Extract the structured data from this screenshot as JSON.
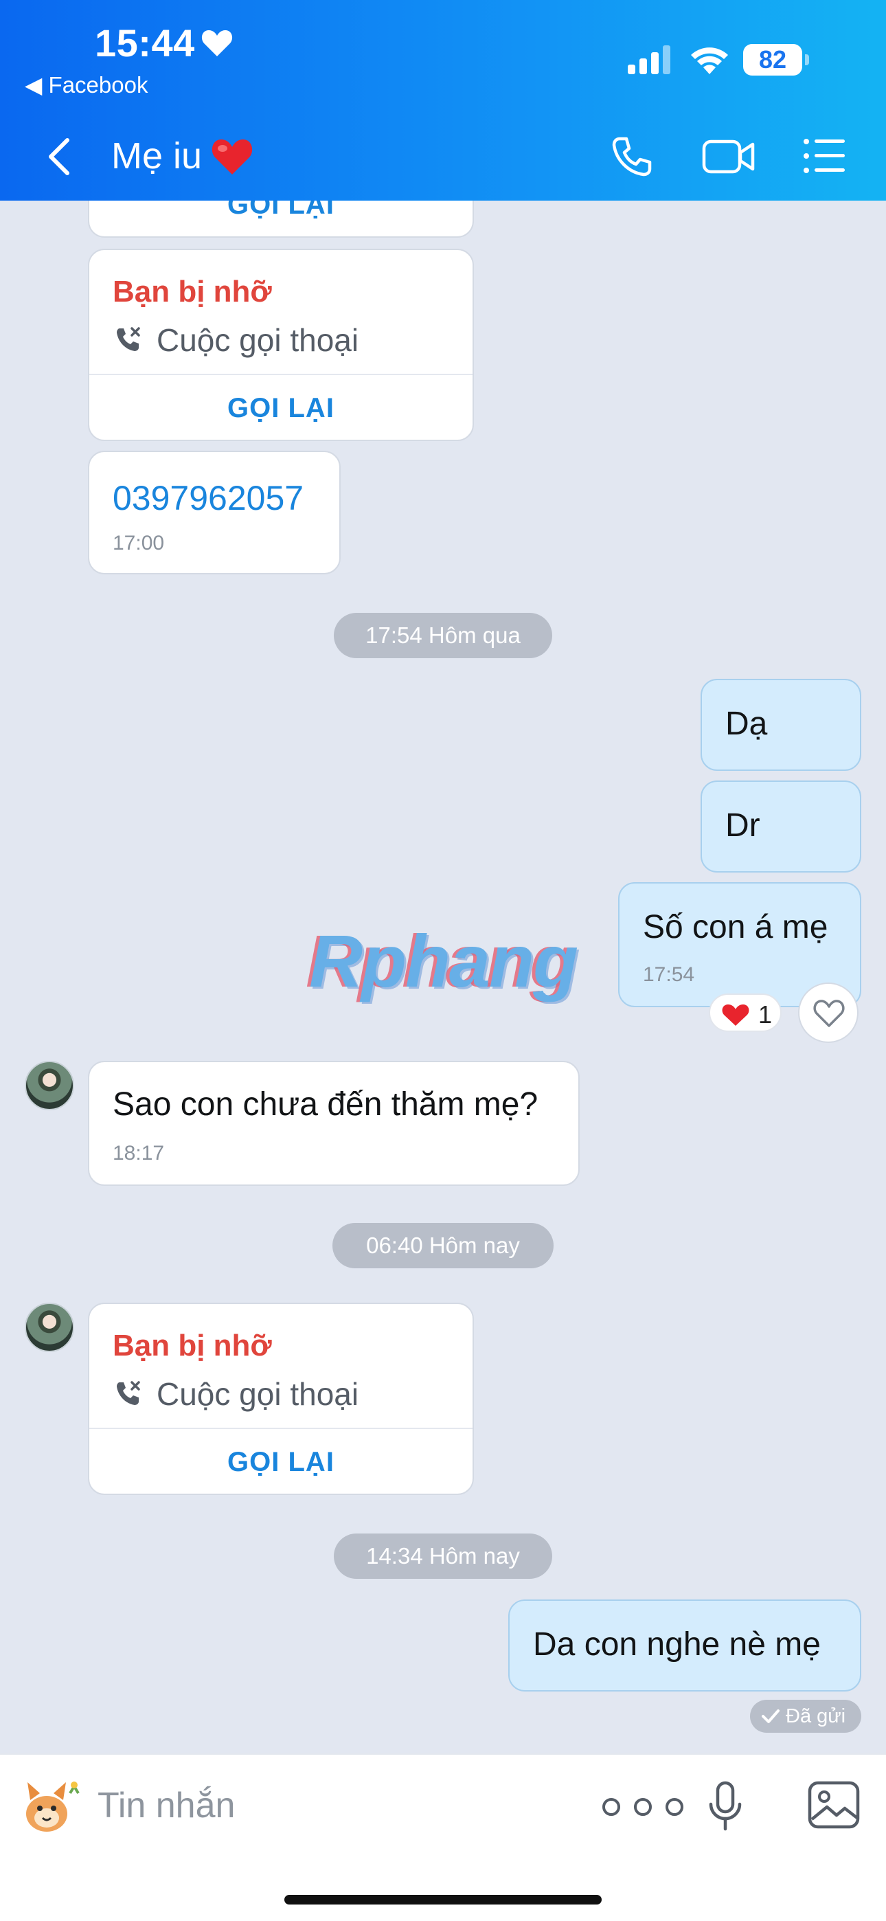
{
  "status_bar": {
    "time": "15:44",
    "back_app": "◀ Facebook",
    "battery": "82"
  },
  "header": {
    "title": "Mẹ iu"
  },
  "messages": {
    "callback_label": "GỌI LẠI",
    "missed_title": "Bạn bị nhỡ",
    "call_type": "Cuộc gọi thoại",
    "phone_number": "0397962057",
    "phone_time": "17:00",
    "date_1": "17:54 Hôm qua",
    "out_1": "Dạ",
    "out_2": "Dr",
    "out_3": "Số con á mẹ",
    "out_3_time": "17:54",
    "reaction_count": "1",
    "in_1": "Sao con chưa đến thăm mẹ?",
    "in_1_time": "18:17",
    "date_2": "06:40 Hôm nay",
    "date_3": "14:34 Hôm nay",
    "out_4": "Da con nghe nè mẹ",
    "sent_status": "Đã gửi"
  },
  "watermark": "Rphang",
  "input": {
    "placeholder": "Tin nhắn"
  },
  "colors": {
    "header_start": "#0a68f0",
    "header_end": "#14b3f3",
    "missed_red": "#e0453c",
    "link_blue": "#1985dd",
    "out_bubble": "#d4ecfd",
    "background": "#e2e7f1"
  },
  "icons": [
    "heart-icon",
    "signal-icon",
    "wifi-icon",
    "battery-icon",
    "back-arrow-icon",
    "phone-icon",
    "video-call-icon",
    "menu-list-icon",
    "missed-call-icon",
    "like-heart-icon",
    "check-icon",
    "sticker-icon",
    "more-dots-icon",
    "microphone-icon",
    "gallery-icon"
  ]
}
